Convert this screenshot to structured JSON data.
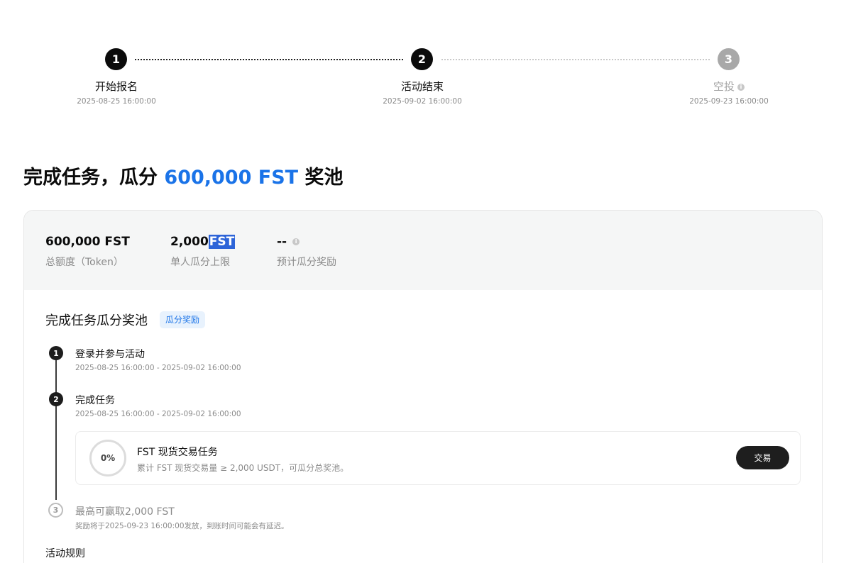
{
  "stepper": {
    "steps": [
      {
        "number": "1",
        "label": "开始报名",
        "date": "2025-08-25 16:00:00",
        "state": "active"
      },
      {
        "number": "2",
        "label": "活动结束",
        "date": "2025-09-02 16:00:00",
        "state": "active"
      },
      {
        "number": "3",
        "label": "空投",
        "date": "2025-09-23 16:00:00",
        "state": "pending"
      }
    ]
  },
  "heading": {
    "prefix": "完成任务，瓜分 ",
    "amount": "600,000 FST",
    "suffix": " 奖池",
    "accent_color": "#1a73e8"
  },
  "stats": {
    "total": {
      "value": "600,000 FST",
      "label": "总额度（Token）"
    },
    "cap": {
      "value_number": "2,000",
      "value_unit": "FST",
      "label": "单人瓜分上限"
    },
    "estimate": {
      "value": "--",
      "label": "预计瓜分奖励"
    }
  },
  "section": {
    "title": "完成任务瓜分奖池",
    "badge": "瓜分奖励"
  },
  "timeline": [
    {
      "number": "1",
      "title": "登录并参与活动",
      "date": "2025-08-25 16:00:00 - 2025-09-02 16:00:00"
    },
    {
      "number": "2",
      "title": "完成任务",
      "date": "2025-08-25 16:00:00 - 2025-09-02 16:00:00"
    },
    {
      "number": "3",
      "title": "最高可赢取2,000 FST",
      "date": "奖励将于2025-09-23 16:00:00发放，到账时间可能会有延迟。"
    }
  ],
  "task": {
    "progress": "0%",
    "title": "FST 现货交易任务",
    "description": "累计 FST 现货交易量 ≥ 2,000 USDT，可瓜分总奖池。",
    "button": "交易"
  },
  "rules": {
    "title": "活动规则"
  }
}
